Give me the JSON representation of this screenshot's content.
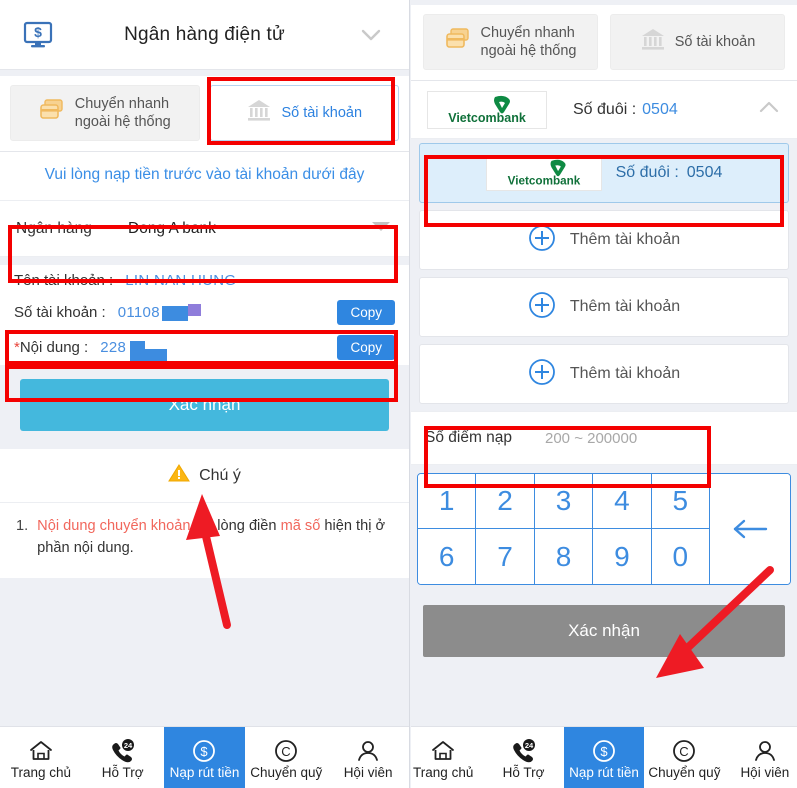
{
  "left": {
    "header": {
      "icon": "monitor-dollar-icon",
      "title": "Ngân hàng điện tử",
      "chevron": "chevron-down-icon"
    },
    "tabs": [
      {
        "label": "Chuyển nhanh\nngoài hệ thống",
        "icon": "cards-icon",
        "active": false
      },
      {
        "label": "Số tài khoản",
        "icon": "bank-icon",
        "active": true
      }
    ],
    "notice": "Vui lòng nạp tiền trước vào tài khoản dưới đây",
    "bank_field": {
      "label": "Ngân hàng",
      "value": "Dong A bank",
      "caret": "caret-down-icon"
    },
    "account_name": {
      "label": "Tên tài khoản :",
      "value": "LIN NAN HUNG"
    },
    "account_number": {
      "label": "Số tài khoản :",
      "value": "01108",
      "copy_label": "Copy"
    },
    "content_field": {
      "star": "*",
      "label": "Nội dung :",
      "value": "228",
      "copy_label": "Copy"
    },
    "confirm_label": "Xác nhận",
    "attention": {
      "icon": "warning-icon",
      "label": "Chú ý"
    },
    "note": {
      "number": "1.",
      "part1": "Nội dung chuyển khoản",
      "part2": " vui lòng điền ",
      "part3": "mã số",
      "part4": " hiện thị ở phần nội dung."
    }
  },
  "right": {
    "tabs": [
      {
        "label": "Chuyển nhanh\nngoài hệ thống",
        "icon": "cards-icon",
        "active": false
      },
      {
        "label": "Số tài khoản",
        "icon": "bank-icon",
        "active": false
      }
    ],
    "bank_header": {
      "logo": "vietcombank-logo",
      "logo_text": "Vietcombank",
      "tail_label": "Số đuôi :",
      "tail_value": "0504",
      "chevron": "chevron-up-icon"
    },
    "accounts": [
      {
        "type": "saved",
        "logo_text": "Vietcombank",
        "tail_label": "Số đuôi :",
        "tail_value": "0504",
        "selected": true
      },
      {
        "type": "add",
        "label": "Thêm tài khoản",
        "icon": "plus-circle-icon"
      },
      {
        "type": "add",
        "label": "Thêm tài khoản",
        "icon": "plus-circle-icon"
      },
      {
        "type": "add",
        "label": "Thêm tài khoản",
        "icon": "plus-circle-icon"
      }
    ],
    "amount": {
      "label": "Số điểm nạp",
      "placeholder": "200 ~ 200000",
      "value": ""
    },
    "keypad": {
      "keys": [
        "1",
        "2",
        "3",
        "4",
        "5",
        "6",
        "7",
        "8",
        "9",
        "0"
      ],
      "backspace": "backspace-arrow-icon"
    },
    "confirm_label": "Xác nhận"
  },
  "bottom_nav": [
    {
      "label": "Trang chủ",
      "icon": "home-icon",
      "active": false
    },
    {
      "label": "Hỗ Trợ",
      "icon": "phone-24-icon",
      "active": false
    },
    {
      "label": "Nạp rút tiền",
      "icon": "dollar-circle-icon",
      "active": true
    },
    {
      "label": "Chuyển quỹ",
      "icon": "c-circle-icon",
      "active": false
    },
    {
      "label": "Hội viên",
      "icon": "user-icon",
      "active": false
    }
  ],
  "colors": {
    "accent_blue": "#2f86e0",
    "confirm_blue": "#44b8dd",
    "confirm_gray": "#8c8c8c",
    "highlight_red": "#f40000",
    "keypad_blue": "#3d8ce0",
    "note_red": "#f1675c",
    "page_bg": "#eef0f5"
  }
}
